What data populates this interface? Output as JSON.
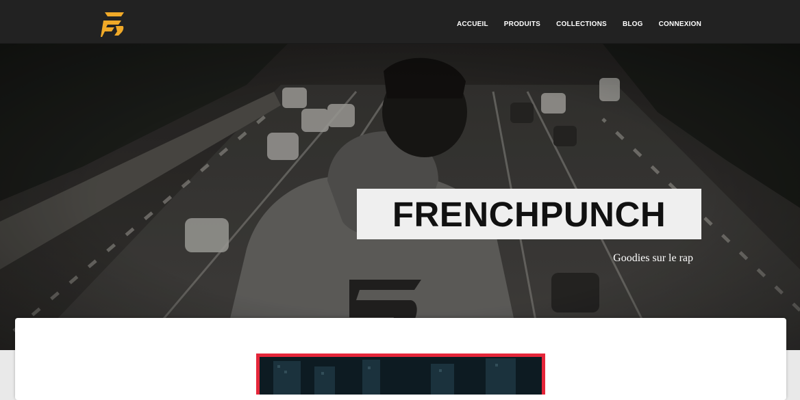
{
  "nav": {
    "logo_alt": "FrenchPunch logo",
    "links": [
      "ACCUEIL",
      "PRODUITS",
      "COLLECTIONS",
      "BLOG",
      "CONNEXION"
    ]
  },
  "hero": {
    "title": "FRENCHPUNCH",
    "subtitle": "Goodies sur le rap"
  },
  "colors": {
    "navbar": "#222222",
    "logo": "#f0a928",
    "accent_border": "#e5263a",
    "title_box": "#efefef"
  },
  "icons": {
    "logo": "frenchpunch-f-logo"
  }
}
